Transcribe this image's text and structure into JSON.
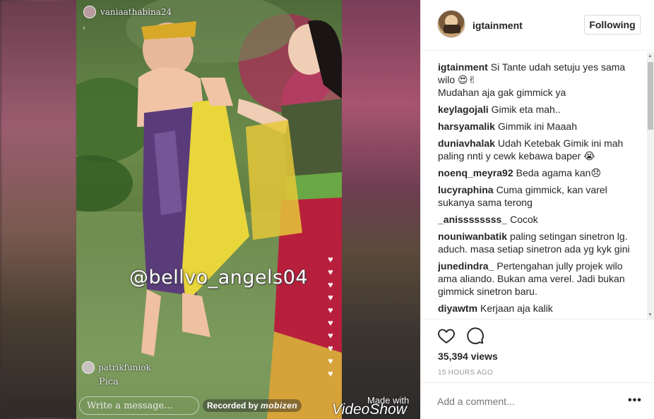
{
  "media": {
    "story_username": "vaniaathabina24",
    "watermark": "@bellvo_angels04",
    "overlay_comment_user": "patrikfuniok",
    "overlay_comment_text": "Pica",
    "write_placeholder": "Write a message...",
    "recorded_by": "Recorded by",
    "recorder_brand": "mobizen",
    "made_with": "Made with",
    "videoshow": "VideoShow"
  },
  "header": {
    "username": "igtainment",
    "follow_label": "Following"
  },
  "comments": [
    {
      "user": "igtainment",
      "text": "Si Tante udah setuju yes sama wilo 😍✌",
      "extra": "Mudahan aja gak gimmick ya"
    },
    {
      "user": "keylagojali",
      "text": "Gimik eta mah.."
    },
    {
      "user": "harsyamalik",
      "text": "Gimmik ini Maaah"
    },
    {
      "user": "duniavhalak",
      "text": "Udah Ketebak Gimik ini mah paling nnti y cewk kebawa baper 😭"
    },
    {
      "user": "noenq_meyra92",
      "text": "Beda agama kan😞"
    },
    {
      "user": "lucyraphina",
      "text": "Cuma gimmick, kan varel sukanya sama terong"
    },
    {
      "user": "_anissssssss_",
      "text": "Cocok"
    },
    {
      "user": "nouniwanbatik",
      "text": "paling setingan sinetron lg. aduch. masa setiap sinetron ada yg kyk gini"
    },
    {
      "user": "junedindra_",
      "text": "Pertengahan jully projek wilo ama aliando. Bukan ama verel. Jadi bukan gimmick sinetron baru."
    },
    {
      "user": "diyawtm",
      "text": "Kerjaan aja kalik"
    }
  ],
  "actions": {
    "like_icon": "heart-outline-icon",
    "comment_icon": "speech-bubble-icon",
    "views": "35,394 views",
    "time_ago": "15 HOURS AGO"
  },
  "add_comment": {
    "placeholder": "Add a comment...",
    "more_label": "•••"
  },
  "colors": {
    "border": "#efefef",
    "text": "#262626",
    "muted": "#999999"
  }
}
